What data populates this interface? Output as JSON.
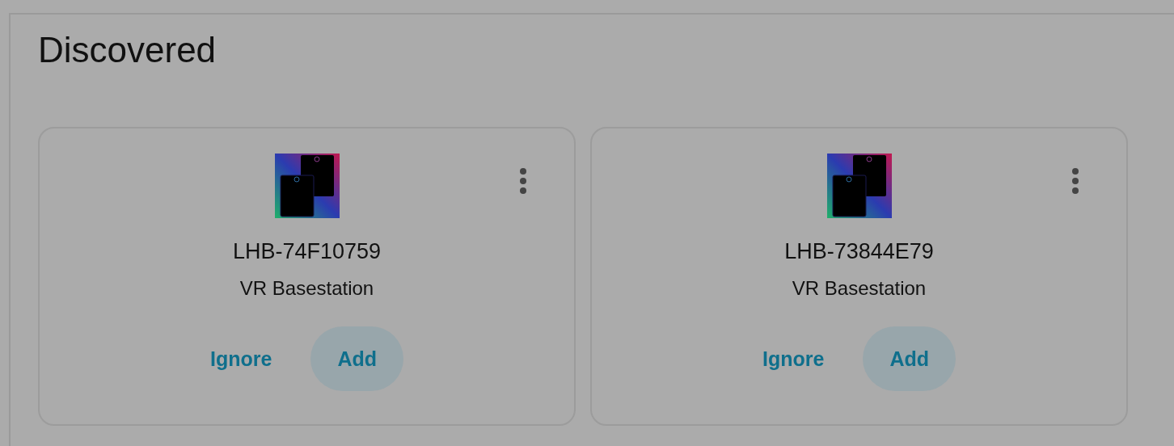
{
  "section": {
    "title": "Discovered"
  },
  "cards": [
    {
      "name": "LHB-74F10759",
      "subtitle": "VR Basestation",
      "actions": [
        {
          "label": "Ignore",
          "kind": "text"
        },
        {
          "label": "Add",
          "kind": "tonal"
        }
      ]
    },
    {
      "name": "LHB-73844E79",
      "subtitle": "VR Basestation",
      "actions": [
        {
          "label": "Ignore",
          "kind": "text"
        },
        {
          "label": "Add",
          "kind": "tonal"
        }
      ]
    }
  ]
}
